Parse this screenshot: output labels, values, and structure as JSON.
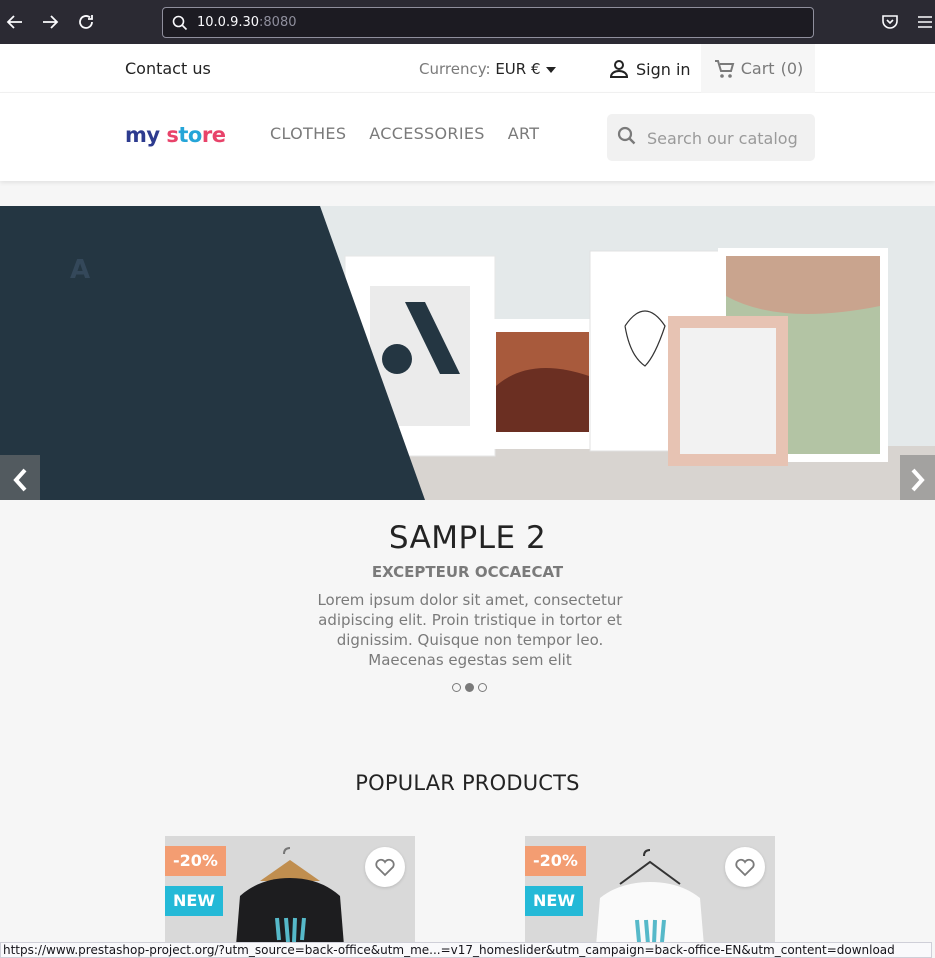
{
  "browser": {
    "url_host": "10.0.9.30",
    "url_port": ":8080",
    "status_url": "https://www.prestashop-project.org/?utm_source=back-office&utm_me...=v17_homeslider&utm_campaign=back-office-EN&utm_content=download"
  },
  "header": {
    "contact_label": "Contact us",
    "currency_label": "Currency:",
    "currency_value": "EUR €",
    "signin_label": "Sign in",
    "cart_label": "Cart",
    "cart_count": "(0)"
  },
  "logo": {
    "part1": "my ",
    "part2": "s",
    "part3": "to",
    "part4": "re"
  },
  "menu": {
    "items": [
      "CLOTHES",
      "ACCESSORIES",
      "ART"
    ]
  },
  "search": {
    "placeholder": "Search our catalog"
  },
  "slider": {
    "title": "SAMPLE 2",
    "subtitle": "EXCEPTEUR OCCAECAT",
    "description": "Lorem ipsum dolor sit amet, consectetur adipiscing elit. Proin tristique in tortor et dignissim. Quisque non tempor leo. Maecenas egestas sem elit",
    "active_index": 1,
    "slide_count": 3
  },
  "popular": {
    "title": "POPULAR PRODUCTS",
    "products": [
      {
        "discount": "-20%",
        "flag": "NEW"
      },
      {
        "discount": "-20%",
        "flag": "NEW"
      }
    ]
  },
  "colors": {
    "accent_discount": "#f39d72",
    "accent_new": "#24b9d7",
    "slider_dark": "#243642"
  },
  "icons": {
    "back": "arrow-left-icon",
    "forward": "arrow-right-icon",
    "reload": "reload-icon",
    "pocket": "pocket-icon",
    "menu": "hamburger-menu-icon",
    "user": "user-icon",
    "cart": "shopping-cart-icon",
    "search": "search-icon",
    "wishlist": "heart-icon"
  }
}
